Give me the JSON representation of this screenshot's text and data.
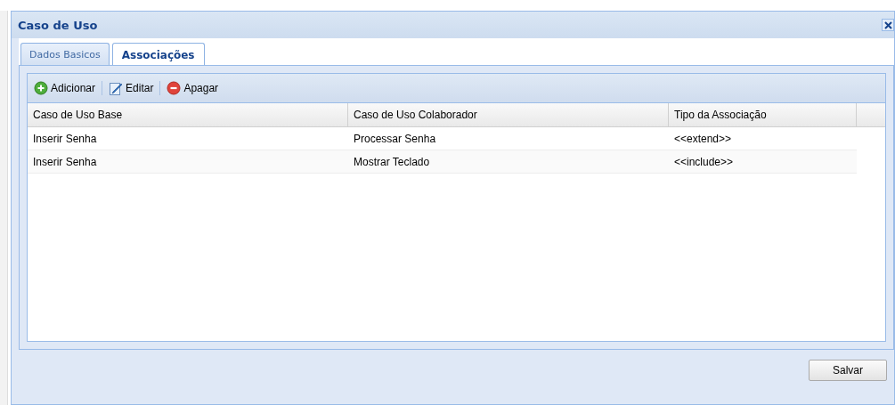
{
  "window": {
    "title": "Caso de Uso"
  },
  "tabs": [
    {
      "label": "Dados Basicos",
      "selected": false
    },
    {
      "label": "Associações",
      "selected": true
    }
  ],
  "toolbar": [
    {
      "kind": "add",
      "label": "Adicionar"
    },
    {
      "kind": "edit",
      "label": "Editar"
    },
    {
      "kind": "delete",
      "label": "Apagar"
    }
  ],
  "table": {
    "columns": [
      "Caso de Uso Base",
      "Caso de Uso Colaborador",
      "Tipo da Associação"
    ],
    "rows": [
      [
        "Inserir Senha",
        "Processar Senha",
        "<<extend>>"
      ],
      [
        "Inserir Senha",
        "Mostrar Teclado",
        "<<include>>"
      ]
    ]
  },
  "buttons": [
    "Salvar"
  ]
}
